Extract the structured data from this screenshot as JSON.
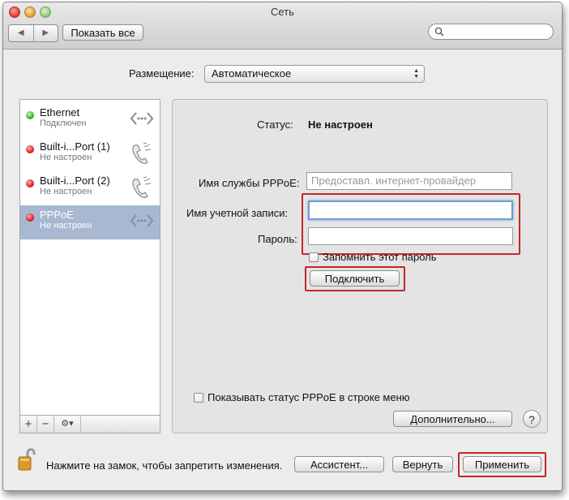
{
  "window": {
    "title": "Сеть"
  },
  "toolbar": {
    "back_glyph": "◀",
    "forward_glyph": "▶",
    "show_all_label": "Показать все",
    "search_placeholder": ""
  },
  "location": {
    "label": "Размещение:",
    "value": "Автоматическое"
  },
  "services": [
    {
      "name": "Ethernet",
      "status": "Подключен",
      "status_color": "green",
      "icon": "ethernet-icon",
      "selected": false
    },
    {
      "name": "Built-i...Port (1)",
      "status": "Не настроен",
      "status_color": "red",
      "icon": "phone-icon",
      "selected": false
    },
    {
      "name": "Built-i...Port (2)",
      "status": "Не настроен",
      "status_color": "red",
      "icon": "phone-icon",
      "selected": false
    },
    {
      "name": "PPPoE",
      "status": "Не настроен",
      "status_color": "red",
      "icon": "ethernet-icon",
      "selected": true
    }
  ],
  "sidebar_actions": {
    "add": "+",
    "remove": "−",
    "gear": "⚙▾"
  },
  "pppoe": {
    "status_label": "Статус:",
    "status_value": "Не настроен",
    "service_name_label": "Имя службы PPPoE:",
    "service_name_placeholder": "Предоставл. интернет-провайдер",
    "account_label": "Имя учетной записи:",
    "account_value": "",
    "password_label": "Пароль:",
    "password_value": "",
    "remember_label": "Запомнить этот пароль",
    "connect_label": "Подключить",
    "show_status_label": "Показывать статус PPPoE в строке меню",
    "advanced_label": "Дополнительно...",
    "help_label": "?"
  },
  "footer": {
    "lock_text": "Нажмите на замок, чтобы запретить изменения.",
    "assistant_label": "Ассистент...",
    "revert_label": "Вернуть",
    "apply_label": "Применить"
  },
  "colors": {
    "highlight": "#c0282a",
    "selection": "#a8b8d3",
    "focus": "#6e9bd8"
  }
}
